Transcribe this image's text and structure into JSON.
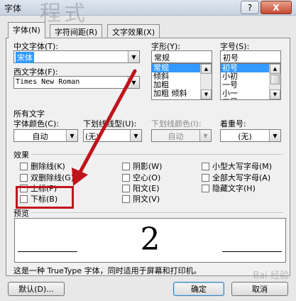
{
  "window": {
    "title": "字体",
    "background_title_text": "程式",
    "help_label": "?",
    "close_label": "X"
  },
  "tabs": [
    {
      "label": "字体(N)",
      "active": true
    },
    {
      "label": "字符间距(R)",
      "active": false
    },
    {
      "label": "文字效果(X)",
      "active": false
    }
  ],
  "font": {
    "chinese_label": "中文字体(T):",
    "chinese_value": "宋体",
    "western_label": "西文字体(F):",
    "western_value": "Times New Roman",
    "style_label": "字形(Y):",
    "style_value": "常规",
    "style_items": [
      "常规",
      "倾斜",
      "加粗",
      "加粗 倾斜"
    ],
    "style_selected": 0,
    "size_label": "字号(S):",
    "size_value": "初号",
    "size_items": [
      "初号",
      "小初",
      "一号",
      "小一",
      "二号"
    ],
    "size_selected": 0
  },
  "all_text": {
    "heading": "所有文字",
    "color_label": "字体颜色(C):",
    "color_value": "自动",
    "underline_label": "下划线线型(U):",
    "underline_value": "(无)",
    "underline_color_label": "下划线颜色(I):",
    "underline_color_value": "自动",
    "emphasis_label": "着重号:",
    "emphasis_value": "(无)"
  },
  "effects": {
    "heading": "效果",
    "items": [
      "删除线(K)",
      "阴影(W)",
      "小型大写字母(M)",
      "双删除线(G)",
      "空心(O)",
      "全部大写字母(A)",
      "上标(P)",
      "阳文(E)",
      "隐藏文字(H)",
      "下标(B)",
      "阴文(V)"
    ]
  },
  "preview": {
    "heading": "预览",
    "text": "2",
    "note": "这是一种 TrueType 字体，同时适用于屏幕和打印机。"
  },
  "buttons": {
    "default_label": "默认(D)...",
    "ok_label": "确定",
    "cancel_label": "取消"
  },
  "annotation": {
    "color": "#c0141c"
  },
  "watermark": "Bai 经验"
}
